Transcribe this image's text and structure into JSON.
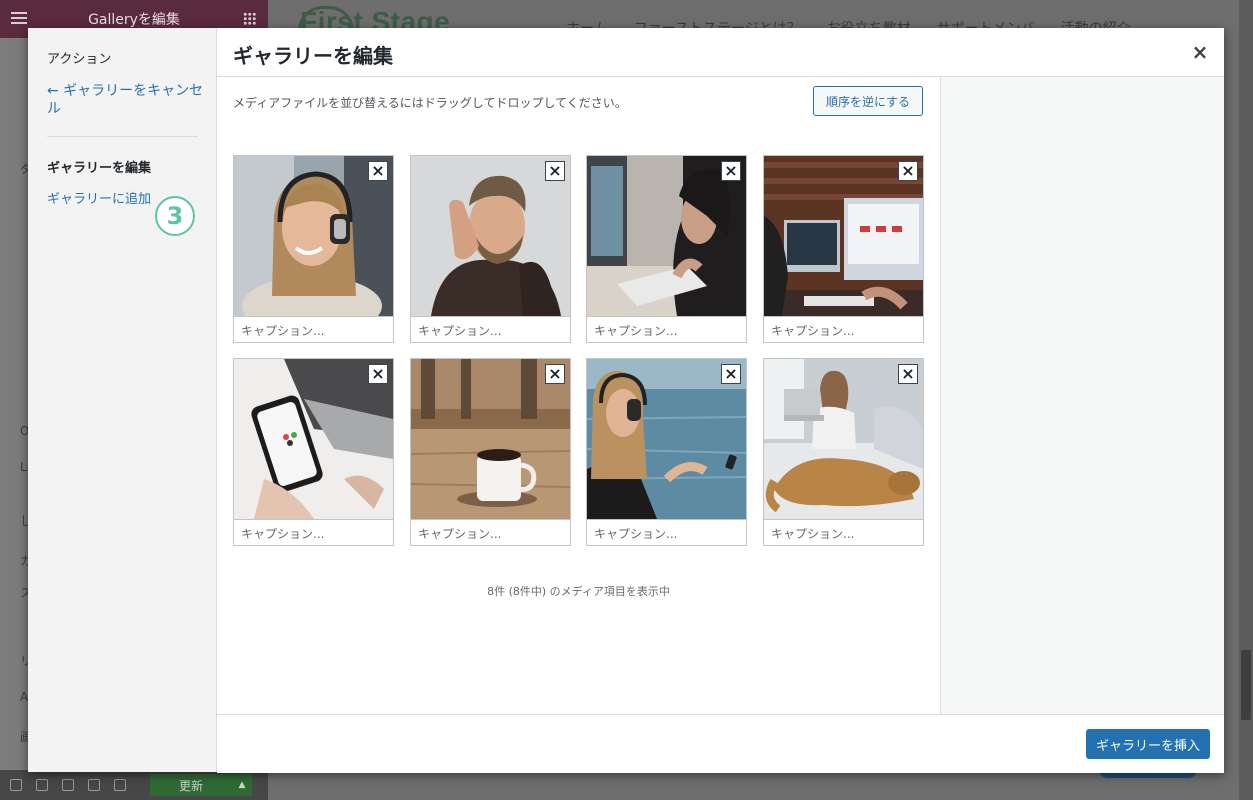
{
  "background": {
    "panel_title": "Galleryを編集",
    "side_letters": [
      "タ",
      "O",
      "Li",
      "し",
      "カ",
      "ス",
      "リ",
      "A",
      "画"
    ],
    "update_label": "更新",
    "logo_text": "First Stage",
    "nav_items": [
      "ホーム",
      "ファーストステージとは？",
      "お役立ち教材",
      "サポートメンバ",
      "活動の紹介"
    ]
  },
  "sidebar": {
    "heading": "アクション",
    "cancel_link": "← ギャラリーをキャンセル",
    "edit_item": "ギャラリーを編集",
    "add_item": "ギャラリーに追加",
    "step_badge": "3"
  },
  "modal": {
    "title": "ギャラリーを編集",
    "close_icon": "×"
  },
  "content": {
    "instructions": "メディアファイルを並び替えるにはドラッグしてドロップしてください。",
    "reverse_button": "順序を逆にする",
    "count_text": "8件 (8件中) のメディア項目を表示中"
  },
  "gallery": {
    "items": [
      {
        "caption_placeholder": "キャプション...",
        "photo": "woman-headphones-smiling"
      },
      {
        "caption_placeholder": "キャプション...",
        "photo": "man-tired-hand-on-face"
      },
      {
        "caption_placeholder": "キャプション...",
        "photo": "woman-typing-laptop"
      },
      {
        "caption_placeholder": "キャプション...",
        "photo": "person-at-imac-desk"
      },
      {
        "caption_placeholder": "キャプション...",
        "photo": "hand-holding-smartphone"
      },
      {
        "caption_placeholder": "キャプション...",
        "photo": "coffee-mug-on-table"
      },
      {
        "caption_placeholder": "キャプション...",
        "photo": "woman-headphones-sea"
      },
      {
        "caption_placeholder": "キャプション...",
        "photo": "woman-laptop-dog-bed"
      }
    ],
    "remove_icon": "×"
  },
  "toolbar": {
    "insert_button": "ギャラリーを挿入"
  },
  "colors": {
    "link": "#2271b1",
    "badge": "#5ec4a1",
    "panel_header": "#5a2a3e"
  }
}
